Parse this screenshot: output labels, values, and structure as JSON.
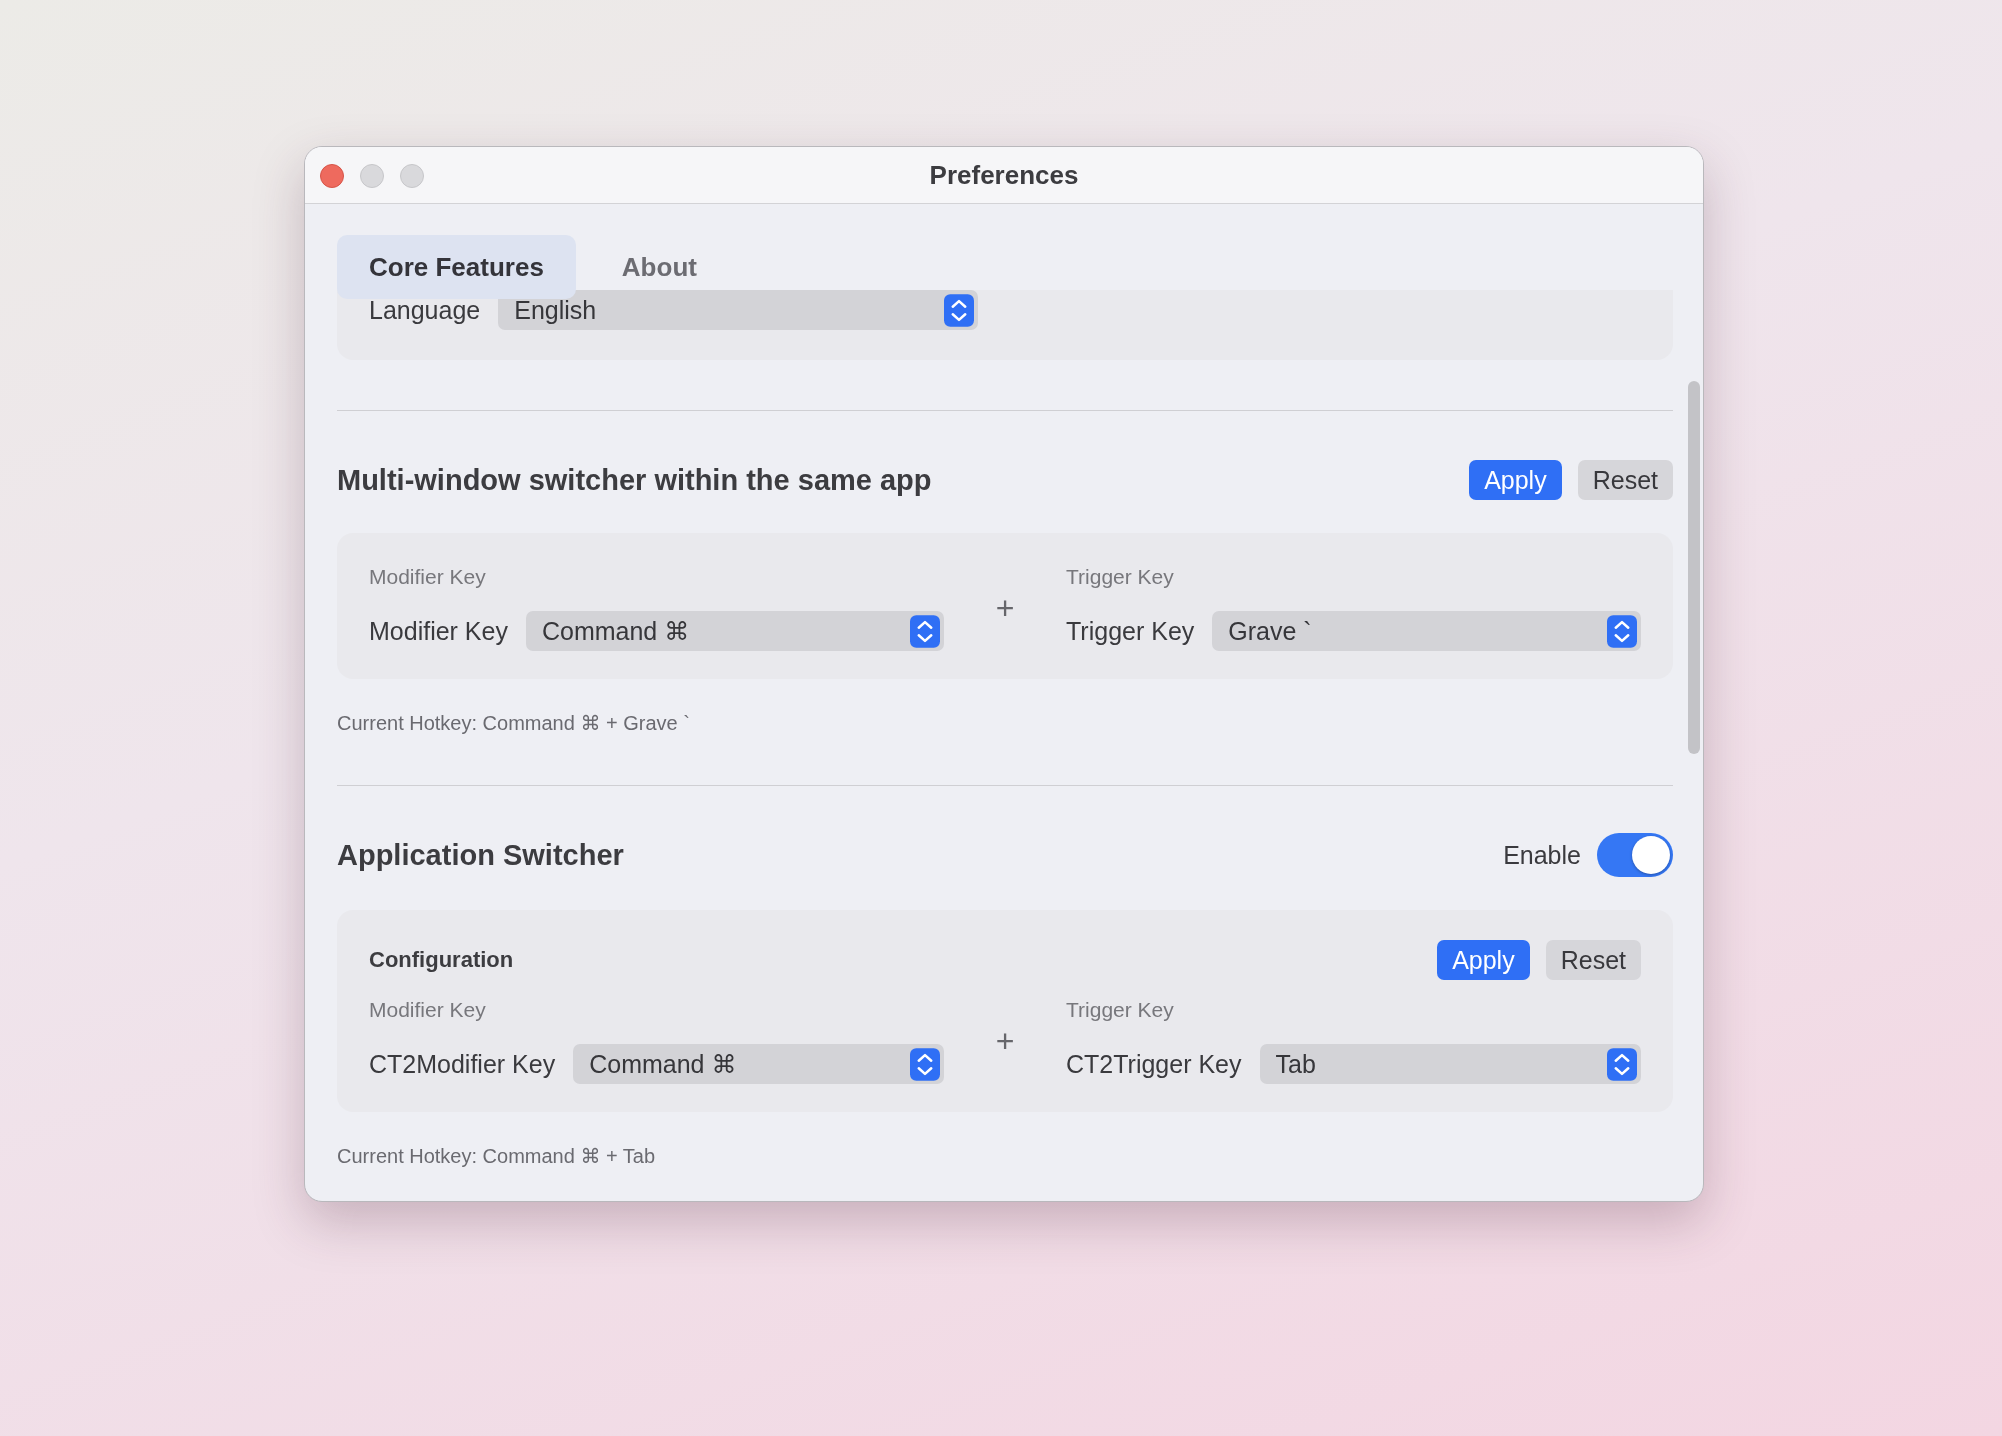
{
  "window": {
    "title": "Preferences"
  },
  "tabs": [
    {
      "label": "Core Features",
      "selected": true
    },
    {
      "label": "About",
      "selected": false
    }
  ],
  "language": {
    "label": "Language",
    "value": "English"
  },
  "sections": [
    {
      "kind": "buttons",
      "title": "Multi-window switcher within the same app",
      "actions": [
        {
          "label": "Apply",
          "primary": true
        },
        {
          "label": "Reset",
          "primary": false
        }
      ],
      "card": {
        "fields": [
          {
            "caption": "Modifier Key",
            "label": "Modifier Key",
            "value": "Command ⌘"
          },
          {
            "caption": "Trigger Key",
            "label": "Trigger Key",
            "value": "Grave `"
          }
        ],
        "joiner": "+"
      },
      "hotkey": "Current Hotkey: Command ⌘ + Grave `"
    },
    {
      "kind": "toggle",
      "title": "Application Switcher",
      "toggle": {
        "label": "Enable",
        "on": true
      },
      "card": {
        "heading": "Configuration",
        "actions": [
          {
            "label": "Apply",
            "primary": true
          },
          {
            "label": "Reset",
            "primary": false
          }
        ],
        "fields": [
          {
            "caption": "Modifier Key",
            "label": "CT2Modifier Key",
            "value": "Command ⌘"
          },
          {
            "caption": "Trigger Key",
            "label": "CT2Trigger Key",
            "value": "Tab"
          }
        ],
        "joiner": "+"
      },
      "hotkey": "Current Hotkey: Command ⌘ + Tab"
    }
  ]
}
